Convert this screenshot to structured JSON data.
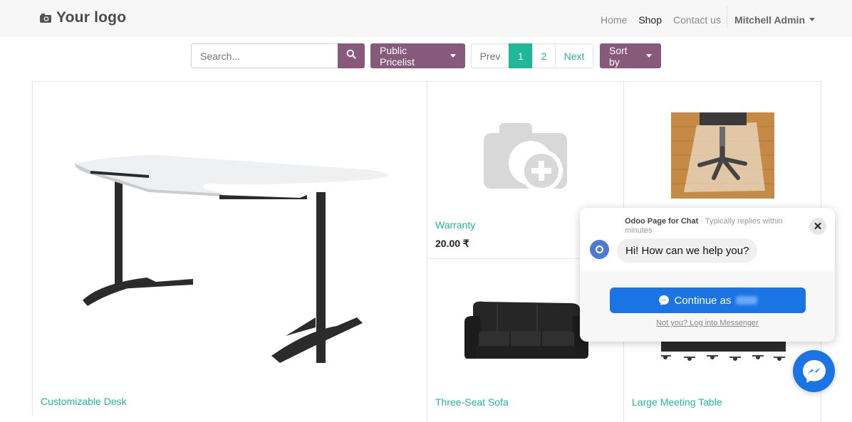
{
  "navbar": {
    "logo_text": "Your logo",
    "links": [
      "Home",
      "Shop",
      "Contact us"
    ],
    "active": "Shop",
    "user": "Mitchell Admin"
  },
  "toolbar": {
    "search_placeholder": "Search...",
    "pricelist_label": "Public Pricelist",
    "pager": {
      "prev": "Prev",
      "pages": [
        "1",
        "2"
      ],
      "current": "1",
      "next": "Next"
    },
    "sort_label": "Sort by"
  },
  "products": [
    {
      "name": "Customizable Desk",
      "price": ""
    },
    {
      "name": "Warranty",
      "price": "20.00 ₹"
    },
    {
      "name": "",
      "price": ""
    },
    {
      "name": "Three-Seat Sofa",
      "price": ""
    },
    {
      "name": "Large Meeting Table",
      "price": ""
    }
  ],
  "chat": {
    "page_name": "Odoo Page for Chat",
    "reply_note": " · Typically replies within minutes",
    "greeting": "Hi! How can we help you?",
    "continue_label": "Continue as",
    "not_you": "Not you? Log into Messenger",
    "close_glyph": "✕",
    "avatar_letter": "O"
  },
  "colors": {
    "brand": "#875a7b",
    "link": "#21b799",
    "messenger": "#1b74e4"
  }
}
